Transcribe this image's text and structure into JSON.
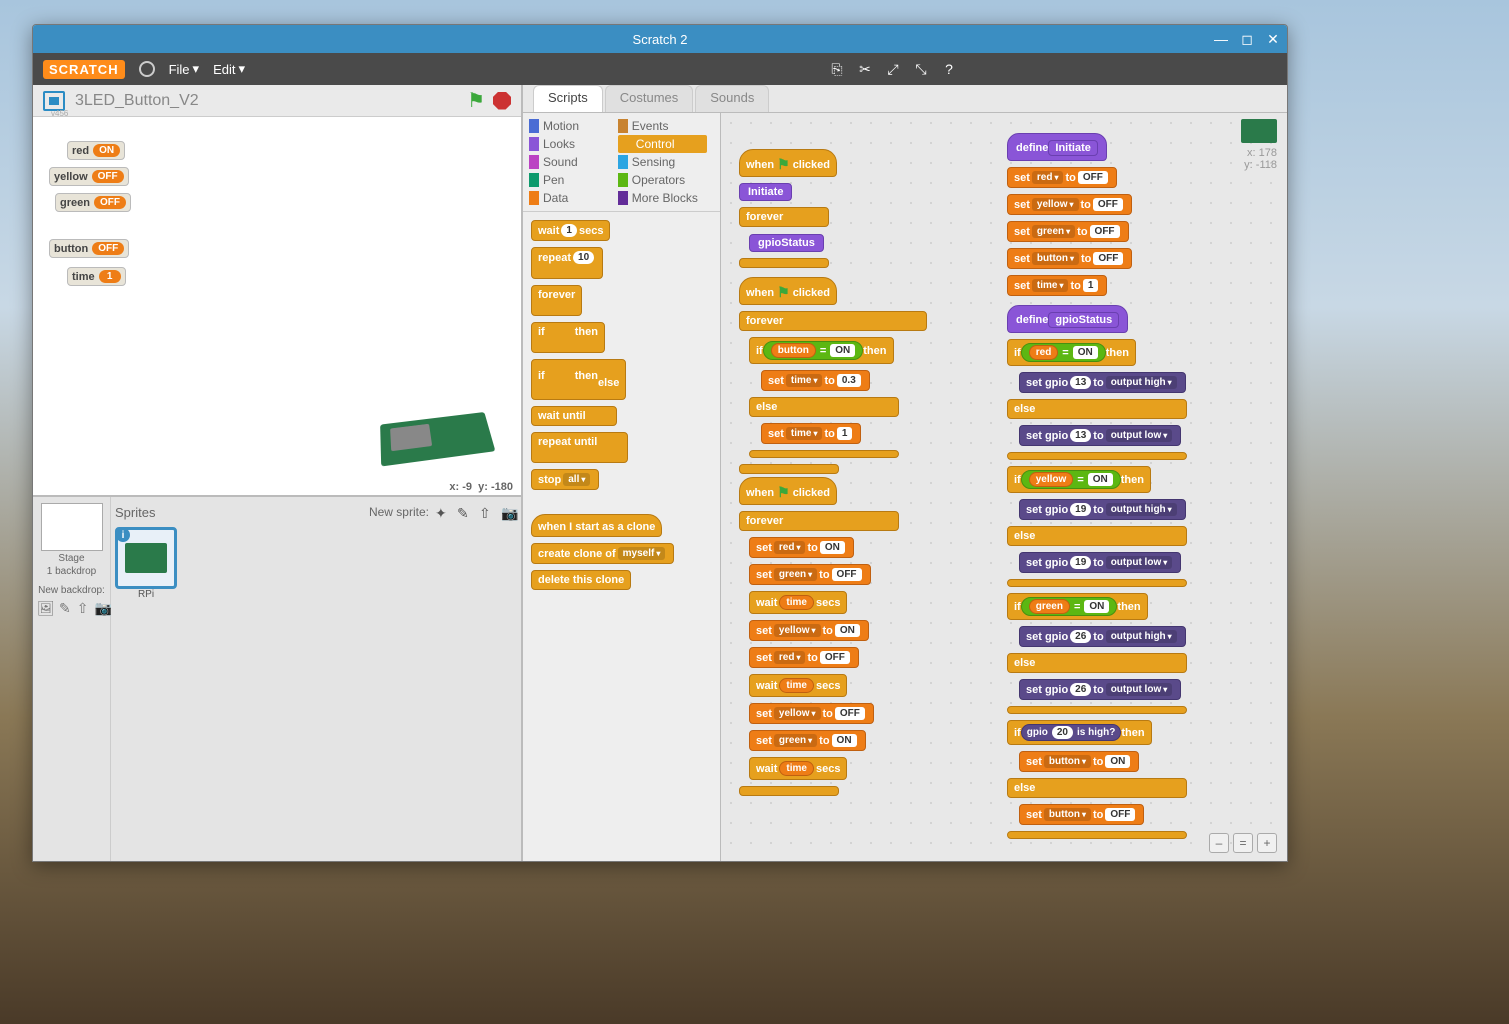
{
  "window": {
    "title": "Scratch 2"
  },
  "menubar": {
    "logo": "SCRATCH",
    "file": "File",
    "edit": "Edit"
  },
  "project": {
    "name": "3LED_Button_V2",
    "version": "v456"
  },
  "stage": {
    "vars": [
      {
        "name": "red",
        "value": "ON"
      },
      {
        "name": "yellow",
        "value": "OFF"
      },
      {
        "name": "green",
        "value": "OFF"
      },
      {
        "name": "button",
        "value": "OFF"
      },
      {
        "name": "time",
        "value": "1"
      }
    ],
    "coords": {
      "x_label": "x:",
      "x": "-9",
      "y_label": "y:",
      "y": "-180"
    }
  },
  "sprites": {
    "heading": "Sprites",
    "new_sprite": "New sprite:",
    "stage_label": "Stage",
    "stage_sub": "1 backdrop",
    "new_backdrop": "New backdrop:",
    "selected_name": "RPi"
  },
  "tabs": {
    "scripts": "Scripts",
    "costumes": "Costumes",
    "sounds": "Sounds"
  },
  "categories": {
    "motion": "Motion",
    "looks": "Looks",
    "sound": "Sound",
    "pen": "Pen",
    "data": "Data",
    "events": "Events",
    "control": "Control",
    "sensing": "Sensing",
    "operators": "Operators",
    "more": "More Blocks"
  },
  "palette": {
    "wait_secs": "wait",
    "secs": "secs",
    "wait_val": "1",
    "repeat": "repeat",
    "repeat_val": "10",
    "forever": "forever",
    "if": "if",
    "then": "then",
    "else": "else",
    "wait_until": "wait until",
    "repeat_until": "repeat until",
    "stop": "stop",
    "stop_opt": "all",
    "when_clone": "when I start as a clone",
    "create_clone": "create clone of",
    "clone_opt": "myself",
    "delete_clone": "delete this clone"
  },
  "scripts": {
    "when_clicked": "when",
    "clicked": "clicked",
    "initiate": "Initiate",
    "gpioStatus": "gpioStatus",
    "forever": "forever",
    "if": "if",
    "then": "then",
    "else": "else",
    "set": "set",
    "to": "to",
    "wait": "wait",
    "secs": "secs",
    "define": "define",
    "button": "button",
    "red": "red",
    "yellow": "yellow",
    "green": "green",
    "time": "time",
    "on": "ON",
    "off": "OFF",
    "one": "1",
    "p03": "0.3",
    "eq": "=",
    "set_gpio": "set gpio",
    "out_high": "output high",
    "out_low": "output low",
    "gpio": "gpio",
    "is_high": "is high?",
    "pins": {
      "r": "13",
      "y": "19",
      "g": "26",
      "btn": "20"
    }
  },
  "canvas": {
    "x_label": "x:",
    "x": "178",
    "y_label": "y:",
    "y": "-118"
  }
}
